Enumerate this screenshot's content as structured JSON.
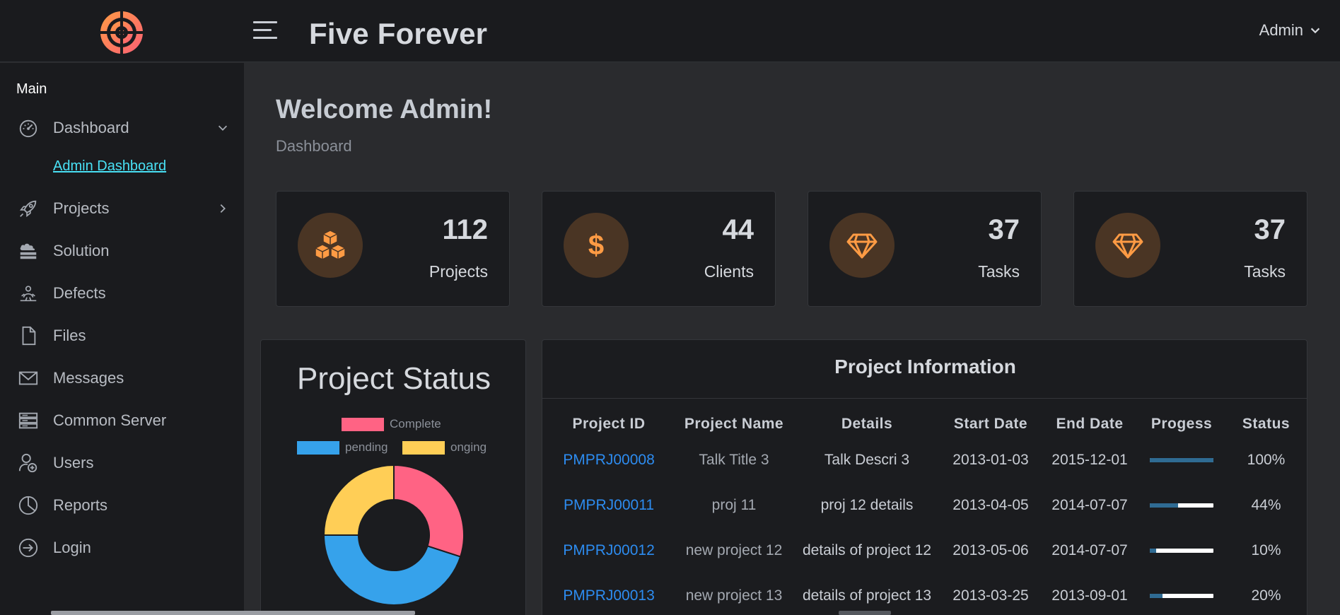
{
  "header": {
    "title": "Five Forever",
    "user_label": "Admin"
  },
  "sidebar": {
    "section": "Main",
    "items": [
      {
        "label": "Dashboard",
        "icon": "gauge-icon"
      },
      {
        "label": "Projects",
        "icon": "rocket-icon"
      },
      {
        "label": "Solution",
        "icon": "cloud-server-icon"
      },
      {
        "label": "Defects",
        "icon": "bug-icon"
      },
      {
        "label": "Files",
        "icon": "file-icon"
      },
      {
        "label": "Messages",
        "icon": "envelope-icon"
      },
      {
        "label": "Common Server",
        "icon": "server-icon"
      },
      {
        "label": "Users",
        "icon": "user-plus-icon"
      },
      {
        "label": "Reports",
        "icon": "pie-icon"
      },
      {
        "label": "Login",
        "icon": "sign-in-icon"
      }
    ],
    "sub_item": "Admin Dashboard"
  },
  "page": {
    "welcome": "Welcome Admin!",
    "breadcrumb": "Dashboard"
  },
  "stats": [
    {
      "value": "112",
      "label": "Projects",
      "icon": "cubes-icon"
    },
    {
      "value": "44",
      "label": "Clients",
      "icon": "dollar-icon"
    },
    {
      "value": "37",
      "label": "Tasks",
      "icon": "diamond-icon"
    },
    {
      "value": "37",
      "label": "Tasks",
      "icon": "diamond-icon"
    }
  ],
  "status_panel": {
    "title": "Project Status",
    "legend": [
      {
        "label": "Complete",
        "color": "#ff6384"
      },
      {
        "label": "pending",
        "color": "#36a2eb"
      },
      {
        "label": "onging",
        "color": "#ffce56"
      }
    ],
    "slices": [
      30,
      45,
      25
    ]
  },
  "info_panel": {
    "title": "Project Information",
    "columns": [
      "Project ID",
      "Project Name",
      "Details",
      "Start Date",
      "End Date",
      "Progess",
      "Status"
    ],
    "rows": [
      {
        "id": "PMPRJ00008",
        "name": "Talk Title 3",
        "details": "Talk Descri 3",
        "start": "2013-01-03",
        "end": "2015-12-01",
        "progress": 1.0,
        "status": "100%"
      },
      {
        "id": "PMPRJ00011",
        "name": "proj 11",
        "details": "proj 12 details",
        "start": "2013-04-05",
        "end": "2014-07-07",
        "progress": 0.44,
        "status": "44%"
      },
      {
        "id": "PMPRJ00012",
        "name": "new project 12",
        "details": "details of project 12",
        "start": "2013-05-06",
        "end": "2014-07-07",
        "progress": 0.1,
        "status": "10%"
      },
      {
        "id": "PMPRJ00013",
        "name": "new project 13",
        "details": "details of project 13",
        "start": "2013-03-25",
        "end": "2013-09-01",
        "progress": 0.2,
        "status": "20%"
      }
    ]
  },
  "colors": {
    "accent_orange": "#ff9b44",
    "link_blue": "#2d8cf0",
    "sub_link": "#49e1f5"
  }
}
